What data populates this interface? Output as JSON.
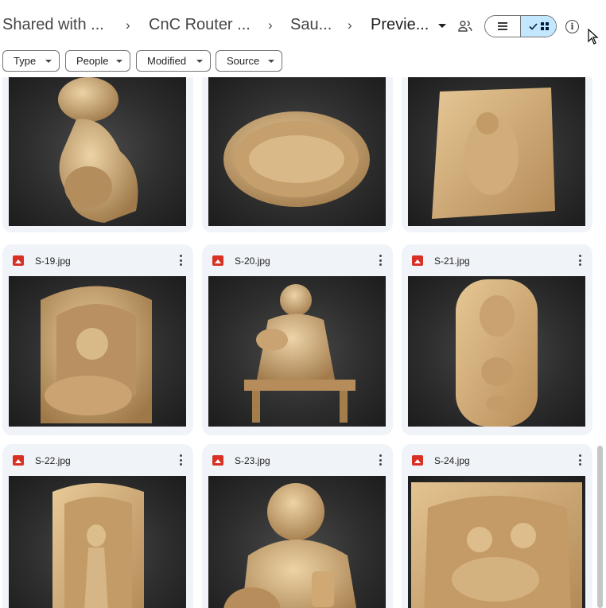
{
  "breadcrumbs": [
    {
      "label": "Shared with ..."
    },
    {
      "label": "CnC Router ..."
    },
    {
      "label": "Sau..."
    },
    {
      "label": "Previe..."
    }
  ],
  "separator": "›",
  "icons": {
    "share": "people-icon",
    "list_view": "list-view-icon",
    "grid_view": "grid-view-icon",
    "check": "check-icon",
    "info": "info-icon",
    "file_type": "image-file-icon",
    "more": "more-vert-icon"
  },
  "filters": [
    {
      "label": "Type"
    },
    {
      "label": "People"
    },
    {
      "label": "Modified"
    },
    {
      "label": "Source"
    }
  ],
  "files": [
    {
      "name": "S-19.jpg"
    },
    {
      "name": "S-20.jpg"
    },
    {
      "name": "S-21.jpg"
    },
    {
      "name": "S-22.jpg"
    },
    {
      "name": "S-23.jpg"
    },
    {
      "name": "S-24.jpg"
    }
  ],
  "colors": {
    "selected_toggle": "#c2e7ff",
    "card_bg": "#f0f4f9",
    "image_icon": "#d93025",
    "carving_wood": "#c9a878"
  }
}
